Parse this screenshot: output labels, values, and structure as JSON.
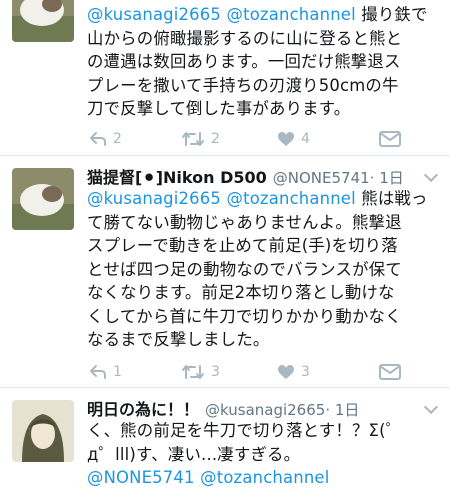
{
  "tweets": [
    {
      "mentions": [
        "@kusanagi2665",
        "@tozanchannel"
      ],
      "text_after": " 撮り鉄で\n山からの俯瞰撮影するのに山に登ると熊と\nの遭遇は数回あります。一回だけ熊撃退ス\nプレーを撒いて手持ちの刃渡り50cmの牛\n刀で反撃して倒した事があります。",
      "actions": {
        "reply": "2",
        "retweet": "2",
        "like": "4"
      }
    },
    {
      "name": "猫提督[⚫]Nikon D500",
      "handle": "@NONE5741",
      "time": "· 1日",
      "mentions": [
        "@kusanagi2665",
        "@tozanchannel"
      ],
      "text_after": " 熊は戦っ\nて勝てない動物じゃありませんよ。熊撃退\nスプレーで動きを止めて前足(手)を切り落\nとせば四つ足の動物なのでバランスが保て\nなくなります。前足2本切り落とし動けな\nくしてから首に牛刀で切りかかり動かなく\nなるまで反撃しました。",
      "actions": {
        "reply": "1",
        "retweet": "3",
        "like": "3"
      }
    },
    {
      "name": "明日の為に！！",
      "handle": "@kusanagi2665",
      "time": "· 1日",
      "text": "く、熊の前足を牛刀で切り落とす！？Σ(゜\nд゜lll)す、凄い...凄すぎる。",
      "mentions_below": [
        "@NONE5741",
        "@tozanchannel"
      ]
    }
  ],
  "colors": {
    "link": "#1b95e0",
    "muted": "#657786",
    "icon": "#aab8c2",
    "divider": "#e1e8ed"
  }
}
